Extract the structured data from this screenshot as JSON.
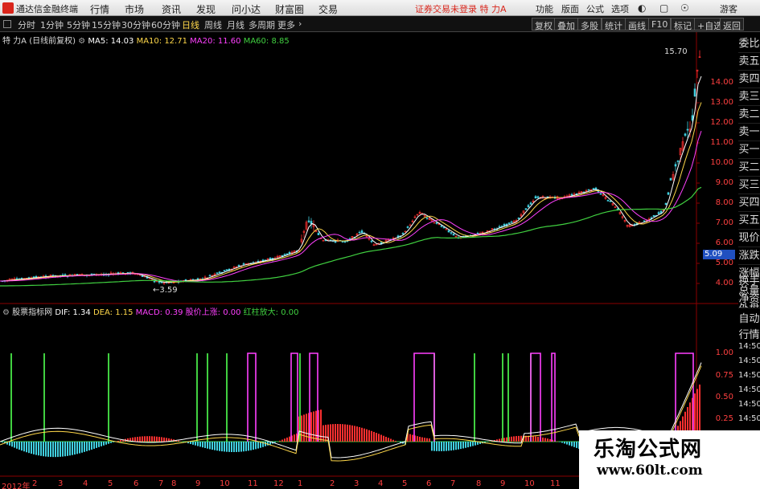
{
  "menubar": {
    "app_name": "通达信金融终端",
    "items": [
      "行情",
      "市场",
      "资讯",
      "发现",
      "问小达",
      "财富圈",
      "交易"
    ],
    "status": "证券交易未登录  特 力A",
    "right_items": [
      "功能",
      "版面",
      "公式",
      "选项"
    ],
    "guest": "游客"
  },
  "toolbar": {
    "periods": [
      "分时",
      "1分钟",
      "5分钟",
      "15分钟",
      "30分钟",
      "60分钟",
      "日线",
      "周线",
      "月线",
      "多周期",
      "更多"
    ],
    "active_period": "日线",
    "buttons": [
      "复权",
      "叠加",
      "多股",
      "统计",
      "画线",
      "F10",
      "标记",
      "+自选",
      "返回"
    ]
  },
  "main_chart": {
    "stock_title": "特 力A",
    "adjust_mode": "(日线前复权)",
    "ma": [
      {
        "label": "MA5: 14.03",
        "color": "#ffffff"
      },
      {
        "label": "MA10: 12.71",
        "color": "#ffd84a"
      },
      {
        "label": "MA20: 11.60",
        "color": "#ff40ff"
      },
      {
        "label": "MA60: 8.85",
        "color": "#40d040"
      }
    ],
    "high_label": "15.70",
    "low_label": "3.59",
    "current_price": "5.09",
    "y_ticks": [
      "14.00",
      "13.00",
      "12.00",
      "11.00",
      "10.00",
      "9.00",
      "8.00",
      "7.00",
      "6.00",
      "5.00",
      "4.00"
    ]
  },
  "sub_chart": {
    "indicator_name": "股票指标网",
    "items": [
      {
        "label": "DIF: 1.34",
        "color": "#ffffff"
      },
      {
        "label": "DEA: 1.15",
        "color": "#ffd84a"
      },
      {
        "label": "MACD: 0.39",
        "color": "#ff40ff"
      },
      {
        "label": "股价上涨: 0.00",
        "color": "#ff40ff"
      },
      {
        "label": "红柱放大: 0.00",
        "color": "#40d040"
      }
    ],
    "y_ticks": [
      "1.00",
      "0.75",
      "0.50",
      "0.25"
    ]
  },
  "sidebar": {
    "items": [
      "委比",
      "卖五",
      "卖四",
      "卖三",
      "卖二",
      "卖一",
      "买一",
      "买二",
      "买三",
      "买四",
      "买五",
      "现价",
      "涨跌",
      "涨幅",
      "总量",
      "外盘",
      "换手",
      "净资",
      "收益"
    ],
    "lower": [
      "自动",
      "行情"
    ],
    "times": [
      "14:50",
      "14:50",
      "14:50",
      "14:50",
      "14:50",
      "14:50"
    ]
  },
  "date_axis": [
    "2012年",
    "2",
    "3",
    "4",
    "5",
    "6",
    "7",
    "8",
    "9",
    "10",
    "11",
    "12",
    "1",
    "2",
    "3",
    "4",
    "5",
    "6",
    "7",
    "8",
    "9",
    "10",
    "11"
  ],
  "watermark": {
    "title": "乐淘公式网",
    "url": "www.60lt.com"
  },
  "colors": {
    "up": "#ff3030",
    "down": "#40d0e0",
    "ma60": "#40d040",
    "macd": "#ff40ff",
    "signal": "#40d040",
    "accent": "#ffd84a"
  }
}
